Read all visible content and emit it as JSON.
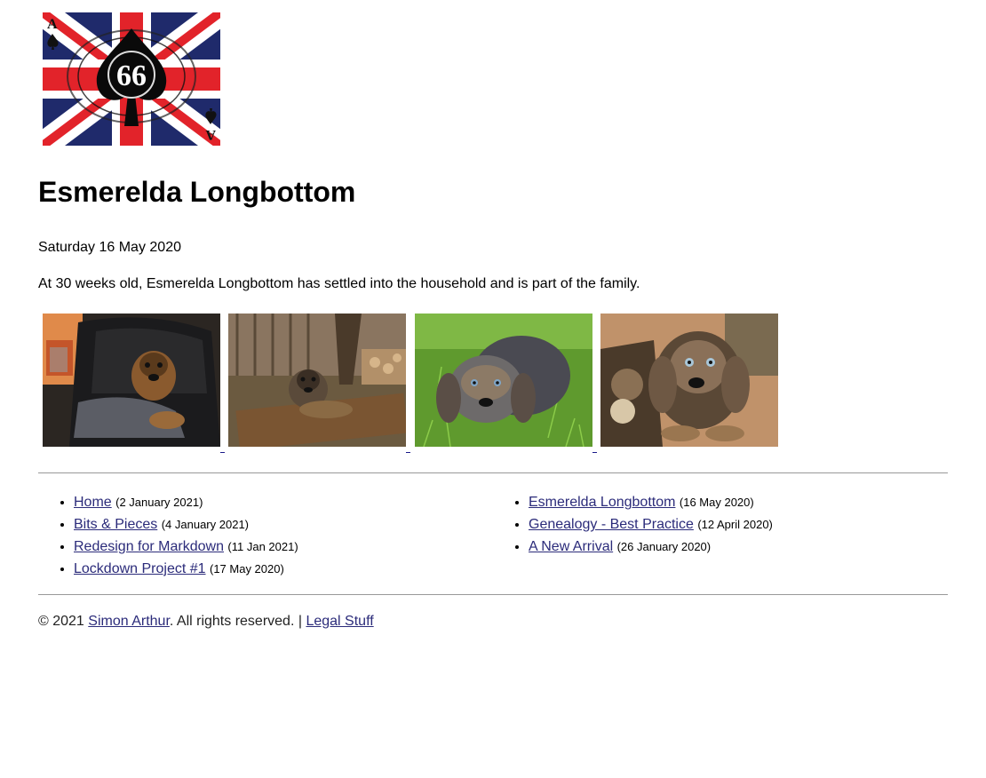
{
  "site": {
    "logo_icon": "ace-of-spades-union-jack-logo",
    "logo_text": "66",
    "logo_card_letter": "A"
  },
  "article": {
    "title": "Esmerelda Longbottom",
    "date": "Saturday 16 May 2020",
    "intro": "At 30 weeks old, Esmerelda Longbottom has settled into the household and is part of the family."
  },
  "gallery": [
    {
      "icon": "puppy-on-leather-chair-photo"
    },
    {
      "icon": "puppy-on-wooden-log-photo"
    },
    {
      "icon": "puppy-on-grass-photo"
    },
    {
      "icon": "puppy-closeup-photo"
    }
  ],
  "nav": {
    "left": [
      {
        "label": "Home",
        "when": "(2 January 2021)"
      },
      {
        "label": "Bits & Pieces",
        "when": "(4 January 2021)"
      },
      {
        "label": "Redesign for Markdown",
        "when": "(11 Jan 2021)"
      },
      {
        "label": "Lockdown Project #1",
        "when": "(17 May 2020)"
      }
    ],
    "right": [
      {
        "label": "Esmerelda Longbottom",
        "when": "(16 May 2020)"
      },
      {
        "label": "Genealogy - Best Practice",
        "when": "(12 April 2020)"
      },
      {
        "label": "A New Arrival",
        "when": "(26 January 2020)"
      }
    ]
  },
  "footer": {
    "copyright": "© 2021",
    "author": "Simon Arthur",
    "rights": ". All rights reserved. |",
    "legal": "Legal Stuff"
  },
  "colors": {
    "link": "#2b2b7a",
    "flag_blue": "#1f2a6b",
    "flag_red": "#e2232a",
    "rule": "#999999"
  }
}
